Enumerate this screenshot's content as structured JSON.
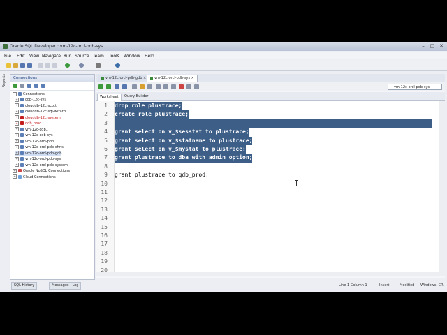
{
  "window": {
    "title": "Oracle SQL Developer : vm-12c-orcl-pdb-sys"
  },
  "menu": [
    "File",
    "Edit",
    "View",
    "Navigate",
    "Run",
    "Source",
    "Team",
    "Tools",
    "Window",
    "Help"
  ],
  "left_tabs": {
    "reports": "Reports"
  },
  "connections_panel": {
    "title": "Connections",
    "root": "Connections",
    "items": [
      {
        "label": "cdb-12c-sys",
        "color": "normal"
      },
      {
        "label": "clouddb-12c-scott",
        "color": "normal"
      },
      {
        "label": "clouddb-12c-sql-wizard",
        "color": "normal"
      },
      {
        "label": "clouddb-12c-system",
        "color": "red"
      },
      {
        "label": "qdb_prod",
        "color": "red"
      },
      {
        "label": "vm-12c-cdb1",
        "color": "normal"
      },
      {
        "label": "vm-12c-cdb-sys",
        "color": "normal"
      },
      {
        "label": "vm-12c-orcl-pdb",
        "color": "normal"
      },
      {
        "label": "vm-12c-orcl-pdb-chris",
        "color": "normal"
      },
      {
        "label": "vm-12c-orcl-pdb-gdb",
        "color": "selected"
      },
      {
        "label": "vm-12c-orcl-pdb-sys",
        "color": "normal"
      },
      {
        "label": "vm-12c-orcl-pdb-system",
        "color": "normal"
      }
    ],
    "extra": [
      "Oracle NoSQL Connections",
      "Cloud Connections"
    ]
  },
  "doc_tabs": [
    {
      "label": "vm-12c-orcl-pdb-gdb",
      "active": false
    },
    {
      "label": "vm-12c-orcl-pdb-sys",
      "active": true
    }
  ],
  "connection_selector": "vm-12c-orcl-pdb-sys",
  "sub_tabs": [
    "Worksheet",
    "Query Builder"
  ],
  "code_lines": [
    {
      "n": "1",
      "text": "drop role plustrace;",
      "hl": true
    },
    {
      "n": "2",
      "text": "create role plustrace;",
      "hl": true
    },
    {
      "n": "3",
      "text": "",
      "hl": true
    },
    {
      "n": "4",
      "text": "grant select on v_$sesstat to plustrace;",
      "hl": true
    },
    {
      "n": "5",
      "text": "grant select on v_$statname to plustrace;",
      "hl": true
    },
    {
      "n": "6",
      "text": "grant select on v_$mystat to plustrace;",
      "hl": true
    },
    {
      "n": "7",
      "text": "grant plustrace to dba with admin option;",
      "hl": true
    },
    {
      "n": "8",
      "text": "",
      "hl": false
    },
    {
      "n": "9",
      "text": "grant plustrace to qdb_prod;",
      "hl": false
    },
    {
      "n": "10",
      "text": "",
      "hl": false
    },
    {
      "n": "11",
      "text": "",
      "hl": false
    },
    {
      "n": "12",
      "text": "",
      "hl": false
    },
    {
      "n": "13",
      "text": "",
      "hl": false
    },
    {
      "n": "14",
      "text": "",
      "hl": false
    },
    {
      "n": "15",
      "text": "",
      "hl": false
    },
    {
      "n": "16",
      "text": "",
      "hl": false
    },
    {
      "n": "17",
      "text": "",
      "hl": false
    },
    {
      "n": "18",
      "text": "",
      "hl": false
    },
    {
      "n": "19",
      "text": "",
      "hl": false
    },
    {
      "n": "20",
      "text": "",
      "hl": false
    }
  ],
  "bottom_tabs": [
    "SQL History",
    "Messages - Log"
  ],
  "status": {
    "position": "Line 1 Column 1",
    "mode": "Insert",
    "state": "Modified",
    "eol": "Windows: CR"
  },
  "colors": {
    "selection": "#3d5e87",
    "accent": "#1f3f7f",
    "red_conn": "#c41c1c"
  }
}
